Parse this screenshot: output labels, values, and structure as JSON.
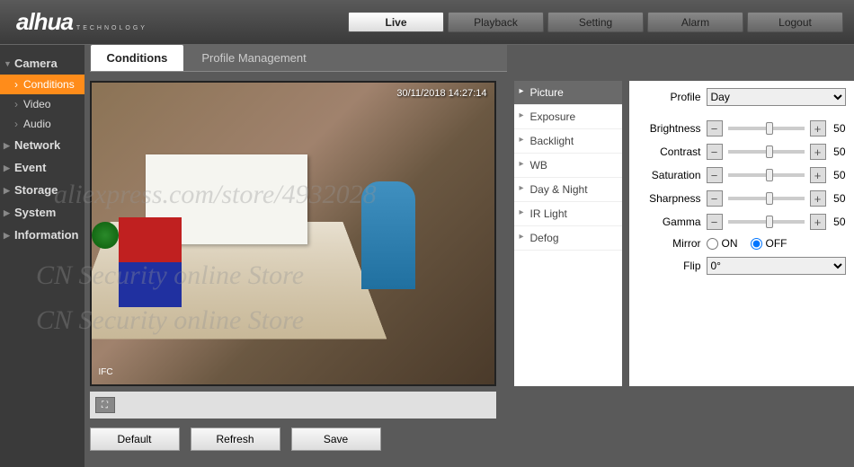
{
  "logo": "alhua",
  "logo_sub": "TECHNOLOGY",
  "nav": {
    "live": "Live",
    "playback": "Playback",
    "setting": "Setting",
    "alarm": "Alarm",
    "logout": "Logout"
  },
  "sidebar": {
    "camera": "Camera",
    "conditions": "Conditions",
    "video": "Video",
    "audio": "Audio",
    "network": "Network",
    "event": "Event",
    "storage": "Storage",
    "system": "System",
    "information": "Information"
  },
  "subtabs": {
    "conditions": "Conditions",
    "profile_mgmt": "Profile Management"
  },
  "video": {
    "timestamp": "30/11/2018 14:27:14",
    "ifc": "IFC"
  },
  "actions": {
    "default": "Default",
    "refresh": "Refresh",
    "save": "Save"
  },
  "settings": {
    "picture": "Picture",
    "exposure": "Exposure",
    "backlight": "Backlight",
    "wb": "WB",
    "daynight": "Day & Night",
    "irlight": "IR Light",
    "defog": "Defog"
  },
  "profile": {
    "label": "Profile",
    "value": "Day"
  },
  "sliders": {
    "brightness": {
      "label": "Brightness",
      "value": "50"
    },
    "contrast": {
      "label": "Contrast",
      "value": "50"
    },
    "saturation": {
      "label": "Saturation",
      "value": "50"
    },
    "sharpness": {
      "label": "Sharpness",
      "value": "50"
    },
    "gamma": {
      "label": "Gamma",
      "value": "50"
    }
  },
  "mirror": {
    "label": "Mirror",
    "on": "ON",
    "off": "OFF"
  },
  "flip": {
    "label": "Flip",
    "value": "0°"
  },
  "watermarks": {
    "w1": "aliexpress.com/store/4932028",
    "w2": "CN Security online Store",
    "w3": "CN Security online Store"
  }
}
